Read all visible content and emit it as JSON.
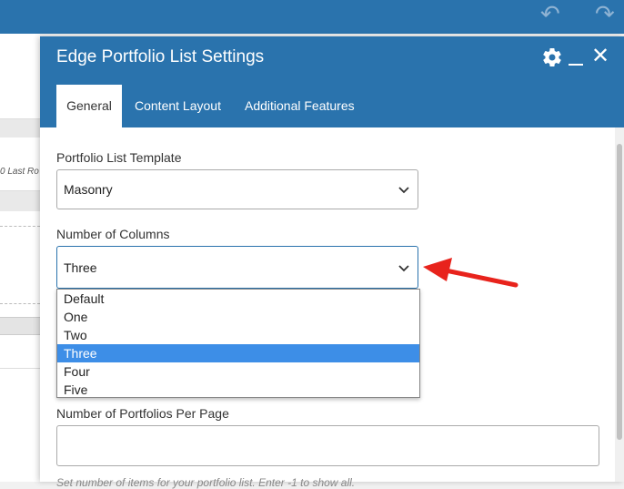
{
  "topbar": {
    "undo_icon": "undo-icon",
    "redo_icon": "redo-icon"
  },
  "background": {
    "partial_text": "0  Last Ro"
  },
  "modal": {
    "title": "Edge Portfolio List Settings",
    "tabs": [
      {
        "label": "General",
        "active": true
      },
      {
        "label": "Content Layout",
        "active": false
      },
      {
        "label": "Additional Features",
        "active": false
      }
    ],
    "fields": {
      "template": {
        "label": "Portfolio List Template",
        "value": "Masonry"
      },
      "columns": {
        "label": "Number of Columns",
        "value": "Three",
        "options": [
          "Default",
          "One",
          "Two",
          "Three",
          "Four",
          "Five"
        ],
        "highlighted": "Three"
      },
      "per_page": {
        "label": "Number of Portfolios Per Page",
        "value": "",
        "hint": "Set number of items for your portfolio list. Enter -1 to show all."
      }
    }
  },
  "colors": {
    "header": "#2a73ad",
    "highlight": "#3d8ee7",
    "arrow": "#e8231c"
  }
}
